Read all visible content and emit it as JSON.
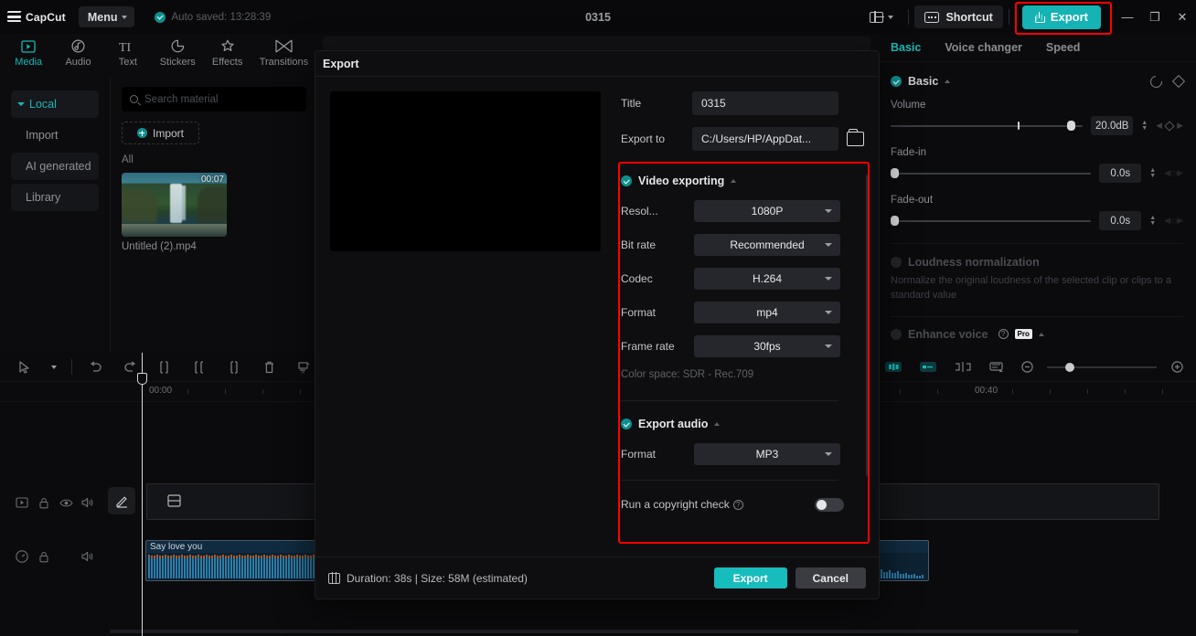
{
  "titlebar": {
    "app_name": "CapCut",
    "menu_label": "Menu",
    "autosave_text": "Auto saved: 13:28:39",
    "project_title": "0315",
    "shortcut_label": "Shortcut",
    "export_label": "Export",
    "minimize": "—",
    "restore": "❐",
    "close": "✕",
    "accent": "#15b3b3",
    "highlight_color": "#ff0000"
  },
  "left_panel": {
    "tabs": [
      {
        "label": "Media",
        "icon": "media-icon",
        "active": true
      },
      {
        "label": "Audio",
        "icon": "audio-icon",
        "active": false
      },
      {
        "label": "Text",
        "icon": "text-icon",
        "active": false
      },
      {
        "label": "Stickers",
        "icon": "stickers-icon",
        "active": false
      },
      {
        "label": "Effects",
        "icon": "effects-icon",
        "active": false
      },
      {
        "label": "Transitions",
        "icon": "transitions-icon",
        "active": false
      }
    ],
    "categories": [
      {
        "label": "Local",
        "active": true
      },
      {
        "label": "Import",
        "active": false
      },
      {
        "label": "AI generated",
        "active": false
      },
      {
        "label": "Library",
        "active": false
      }
    ],
    "search_placeholder": "Search material",
    "import_label": "Import",
    "group_label": "All",
    "media_item": {
      "name": "Untitled (2).mp4",
      "duration": "00:07"
    }
  },
  "right_panel": {
    "tabs": [
      {
        "label": "Basic",
        "active": true
      },
      {
        "label": "Voice changer",
        "active": false
      },
      {
        "label": "Speed",
        "active": false
      }
    ],
    "basic_section": "Basic",
    "volume_label": "Volume",
    "volume_value": "20.0dB",
    "fade_in_label": "Fade-in",
    "fade_in_value": "0.0s",
    "fade_out_label": "Fade-out",
    "fade_out_value": "0.0s",
    "loudness_label": "Loudness normalization",
    "loudness_desc": "Normalize the original loudness of the selected clip or clips to a standard value",
    "enhance_label": "Enhance voice",
    "pro_badge": "Pro"
  },
  "timeline": {
    "ruler_start": "00:00",
    "ruler_mid": "00:40",
    "audio_clip_label": "Say love you"
  },
  "export_dialog": {
    "title": "Export",
    "title_label": "Title",
    "title_value": "0315",
    "export_to_label": "Export to",
    "export_to_value": "C:/Users/HP/AppDat...",
    "video_section": "Video exporting",
    "fields": [
      {
        "label": "Resol...",
        "value": "1080P"
      },
      {
        "label": "Bit rate",
        "value": "Recommended"
      },
      {
        "label": "Codec",
        "value": "H.264"
      },
      {
        "label": "Format",
        "value": "mp4"
      },
      {
        "label": "Frame rate",
        "value": "30fps"
      }
    ],
    "color_space": "Color space: SDR - Rec.709",
    "audio_section": "Export audio",
    "audio_format_label": "Format",
    "audio_format_value": "MP3",
    "copyright_label": "Run a copyright check",
    "footer_info": "Duration: 38s | Size: 58M (estimated)",
    "export_button": "Export",
    "cancel_button": "Cancel"
  }
}
